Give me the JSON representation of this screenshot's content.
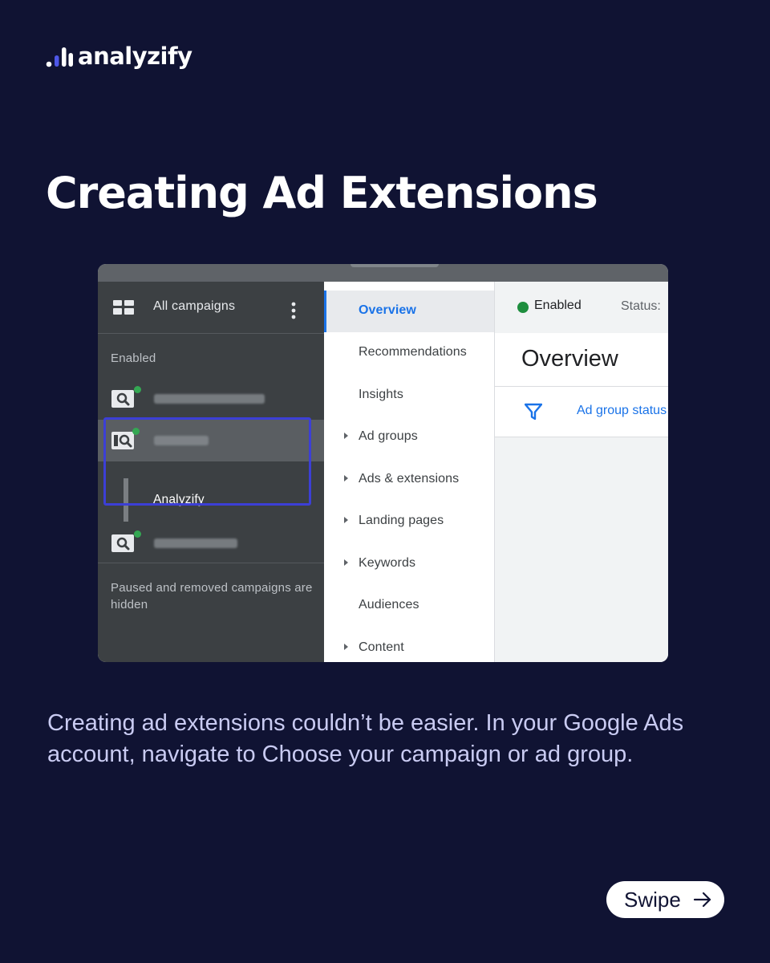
{
  "brand": {
    "name": "analyzify"
  },
  "headline": "Creating Ad Extensions",
  "screenshot": {
    "sidebar": {
      "header_label": "All campaigns",
      "section_label": "Enabled",
      "selected_ad_group": "Analyzify",
      "footer_note": "Paused and removed campaigns are hidden"
    },
    "nav": {
      "items": [
        {
          "label": "Overview"
        },
        {
          "label": "Recommendations"
        },
        {
          "label": "Insights"
        },
        {
          "label": "Ad groups"
        },
        {
          "label": "Ads & extensions"
        },
        {
          "label": "Landing pages"
        },
        {
          "label": "Keywords"
        },
        {
          "label": "Audiences"
        },
        {
          "label": "Content"
        }
      ]
    },
    "content": {
      "status_enabled": "Enabled",
      "status_label": "Status:",
      "title": "Overview",
      "filter_label": "Ad group status"
    }
  },
  "body_text": "Creating ad extensions couldn’t be easier. In your Google Ads account, navigate to Choose your campaign or ad group.",
  "swipe": {
    "label": "Swipe"
  },
  "colors": {
    "background": "#101333",
    "body_text": "#c9cbf2",
    "highlight_box": "#3c3fd6",
    "google_blue": "#1a73e8",
    "enabled_green": "#1e8e3e"
  }
}
